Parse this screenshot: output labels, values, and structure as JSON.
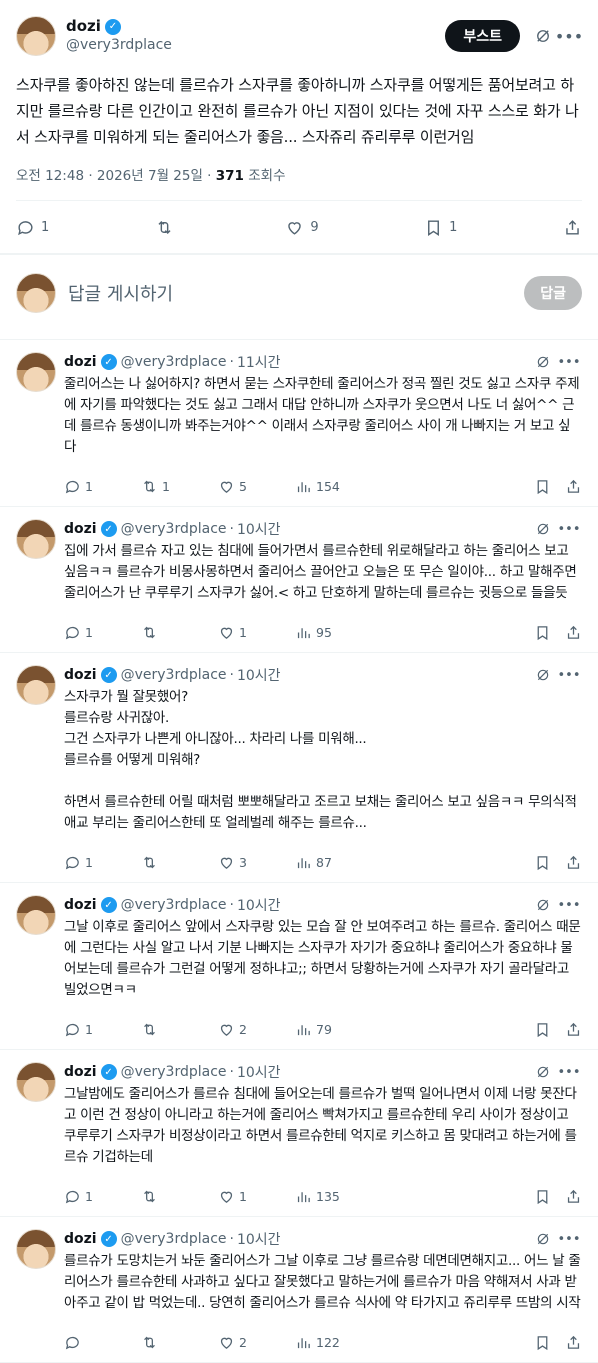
{
  "main": {
    "author_name": "dozi",
    "author_handle": "@very3rdplace",
    "boost_label": "부스트",
    "text": "스자쿠를 좋아하진 않는데 를르슈가 스자쿠를 좋아하니까 스자쿠를 어떻게든 품어보려고 하지만 를르슈랑 다른 인간이고 완전히 를르슈가 아닌 지점이 있다는 것에 자꾸 스스로 화가 나서 스자쿠를 미워하게 되는 줄리어스가 좋음... 스자쥬리 쥬리루루 이런거임",
    "timestamp": "오전 12:48 · 2026년 7월 25일 · ",
    "views": "371",
    "views_label": " 조회수",
    "stats": {
      "replies": "1",
      "retweets": "",
      "likes": "9",
      "bookmarks": "1"
    }
  },
  "compose": {
    "placeholder": "답글 게시하기",
    "button": "답글"
  },
  "replies": [
    {
      "name": "dozi",
      "handle": "@very3rdplace",
      "time": "11시간",
      "text": "줄리어스는 나 싫어하지? 하면서 묻는 스자쿠한테 줄리어스가 정곡 찔린 것도 싫고 스자쿠 주제에 자기를 파악했다는 것도 싫고 그래서 대답 안하니까 스자쿠가 웃으면서 나도 너 싫어^^ 근데 를르슈 동생이니까 봐주는거야^^ 이래서 스자쿠랑 줄리어스 사이 개 나빠지는 거 보고 싶다",
      "replies": "1",
      "retweets": "1",
      "likes": "5",
      "views": "154"
    },
    {
      "name": "dozi",
      "handle": "@very3rdplace",
      "time": "10시간",
      "text": "집에 가서 를르슈 자고 있는 침대에 들어가면서 를르슈한테 위로해달라고 하는 줄리어스 보고 싶음ㅋㅋ 를르슈가 비몽사몽하면서 줄리어스 끌어안고 오늘은 또 무슨 일이야... 하고 말해주면 줄리어스가 난 쿠루루기 스자쿠가 싫어.< 하고 단호하게 말하는데 를르슈는 귓등으로 들을듯",
      "replies": "1",
      "retweets": "",
      "likes": "1",
      "views": "95"
    },
    {
      "name": "dozi",
      "handle": "@very3rdplace",
      "time": "10시간",
      "text": "스자쿠가 뭘 잘못했어?\n를르슈랑 사귀잖아.\n그건 스자쿠가 나쁜게 아니잖아... 차라리 나를 미워해...\n를르슈를 어떻게 미워해?\n\n하면서 를르슈한테 어릴 때처럼 뽀뽀해달라고 조르고 보채는 줄리어스 보고 싶음ㅋㅋ 무의식적 애교 부리는 줄리어스한테 또 얼레벌레 해주는 를르슈...",
      "replies": "1",
      "retweets": "",
      "likes": "3",
      "views": "87"
    },
    {
      "name": "dozi",
      "handle": "@very3rdplace",
      "time": "10시간",
      "text": "그날 이후로 줄리어스 앞에서 스자쿠랑 있는 모습 잘 안 보여주려고 하는 를르슈. 줄리어스 때문에 그런다는 사실 알고 나서 기분 나빠지는 스자쿠가 자기가 중요하냐 줄리어스가 중요하냐 물어보는데 를르슈가 그런걸 어떻게 정하냐고;; 하면서 당황하는거에 스자쿠가 자기 골라달라고 빌었으면ㅋㅋ",
      "replies": "1",
      "retweets": "",
      "likes": "2",
      "views": "79"
    },
    {
      "name": "dozi",
      "handle": "@very3rdplace",
      "time": "10시간",
      "text": "그날밤에도 줄리어스가 를르슈 침대에 들어오는데 를르슈가 벌떡 일어나면서 이제 너랑 못잔다고 이런 건 정상이 아니라고 하는거에 줄리어스 빡쳐가지고 를르슈한테 우리 사이가 정상이고 쿠루루기 스자쿠가 비정상이라고 하면서 를르슈한테 억지로 키스하고 몸 맞대려고 하는거에 를르슈 기겁하는데",
      "replies": "1",
      "retweets": "",
      "likes": "1",
      "views": "135"
    },
    {
      "name": "dozi",
      "handle": "@very3rdplace",
      "time": "10시간",
      "text": "를르슈가 도망치는거 놔둔 줄리어스가 그날 이후로 그냥 를르슈랑 데면데면해지고... 어느 날 줄리어스가 를르슈한테 사과하고 싶다고 잘못했다고 말하는거에 를르슈가 마음 약해져서 사과 받아주고 같이 밥 먹었는데.. 당연히 줄리어스가 를르슈 식사에 약 타가지고 쥬리루루 뜨밤의 시작",
      "replies": "",
      "retweets": "",
      "likes": "2",
      "views": "122"
    }
  ]
}
